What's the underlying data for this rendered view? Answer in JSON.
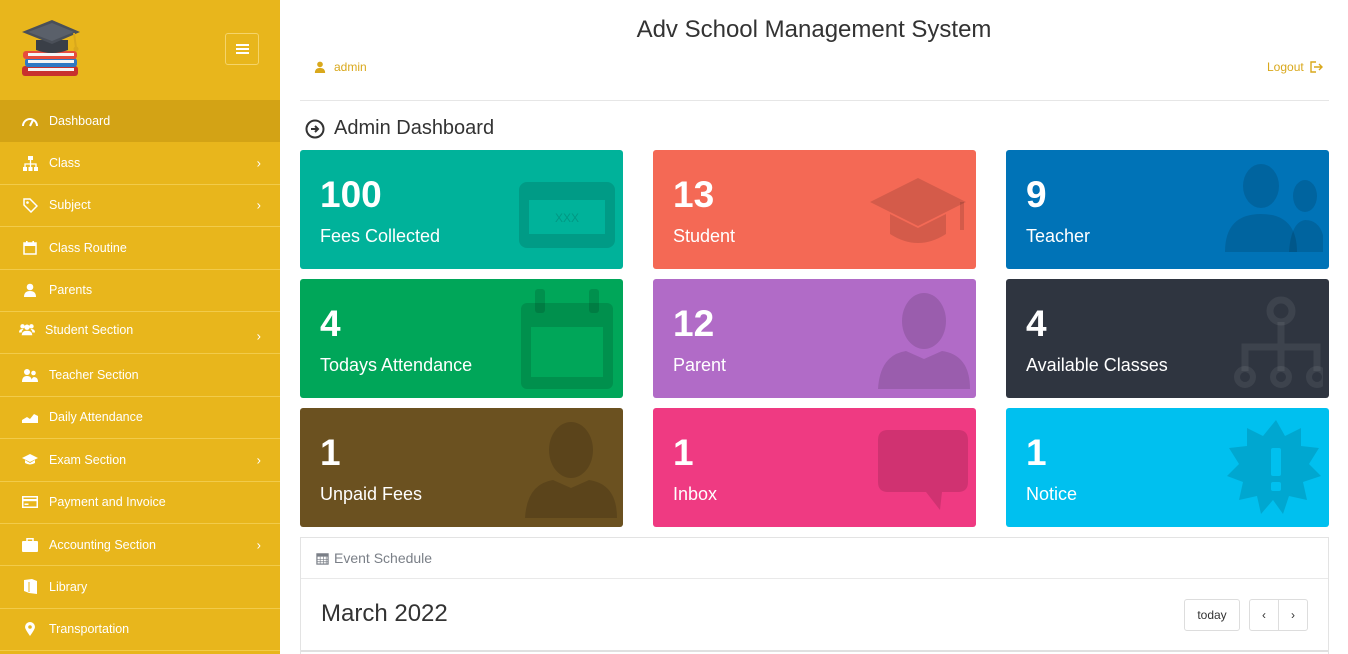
{
  "header": {
    "title": "Adv School Management System",
    "user": "admin",
    "logout": "Logout"
  },
  "dashboard": {
    "title": "Admin Dashboard"
  },
  "sidebar": {
    "items": [
      {
        "label": "Dashboard",
        "icon": "dashboard-gauge-icon",
        "active": true,
        "chevron": false
      },
      {
        "label": "Class",
        "icon": "sitemap-icon",
        "chevron": true
      },
      {
        "label": "Subject",
        "icon": "tag-icon",
        "chevron": true
      },
      {
        "label": "Class Routine",
        "icon": "calendar-icon",
        "chevron": false
      },
      {
        "label": "Parents",
        "icon": "user-icon",
        "chevron": false
      },
      {
        "label": "Student Section",
        "icon": "users-icon",
        "chevron": true
      },
      {
        "label": "Teacher Section",
        "icon": "user-group-icon",
        "chevron": false
      },
      {
        "label": "Daily Attendance",
        "icon": "area-chart-icon",
        "chevron": false
      },
      {
        "label": "Exam Section",
        "icon": "graduation-cap-icon",
        "chevron": true
      },
      {
        "label": "Payment and Invoice",
        "icon": "credit-card-icon",
        "chevron": false
      },
      {
        "label": "Accounting Section",
        "icon": "briefcase-icon",
        "chevron": true
      },
      {
        "label": "Library",
        "icon": "book-icon",
        "chevron": false
      },
      {
        "label": "Transportation",
        "icon": "map-marker-icon",
        "chevron": false
      }
    ],
    "chevron_glyph": "›"
  },
  "cards": [
    {
      "value": "100",
      "label": "Fees Collected",
      "color": "#00b29a",
      "icon": "money-card-icon"
    },
    {
      "value": "13",
      "label": "Student",
      "color": "#f46955",
      "icon": "graduation-cap-icon"
    },
    {
      "value": "9",
      "label": "Teacher",
      "color": "#0073b7",
      "icon": "users-icon"
    },
    {
      "value": "4",
      "label": "Todays Attendance",
      "color": "#00a659",
      "icon": "calendar-icon"
    },
    {
      "value": "12",
      "label": "Parent",
      "color": "#b16bc7",
      "icon": "user-icon"
    },
    {
      "value": "4",
      "label": "Available Classes",
      "color": "#2f3540",
      "icon": "sitemap-icon"
    },
    {
      "value": "1",
      "label": "Unpaid Fees",
      "color": "#6b5120",
      "icon": "user-icon"
    },
    {
      "value": "1",
      "label": "Inbox",
      "color": "#ef3a82",
      "icon": "comment-icon"
    },
    {
      "value": "1",
      "label": "Notice",
      "color": "#00c0ef",
      "icon": "certificate-icon"
    }
  ],
  "schedule": {
    "title": "Event Schedule",
    "month": "March 2022",
    "today_label": "today",
    "prev_label": "‹",
    "next_label": "›"
  },
  "colors": {
    "sidebar": "#e8b61c",
    "sidebar_active": "#d3a315",
    "link": "#d9a81c"
  }
}
